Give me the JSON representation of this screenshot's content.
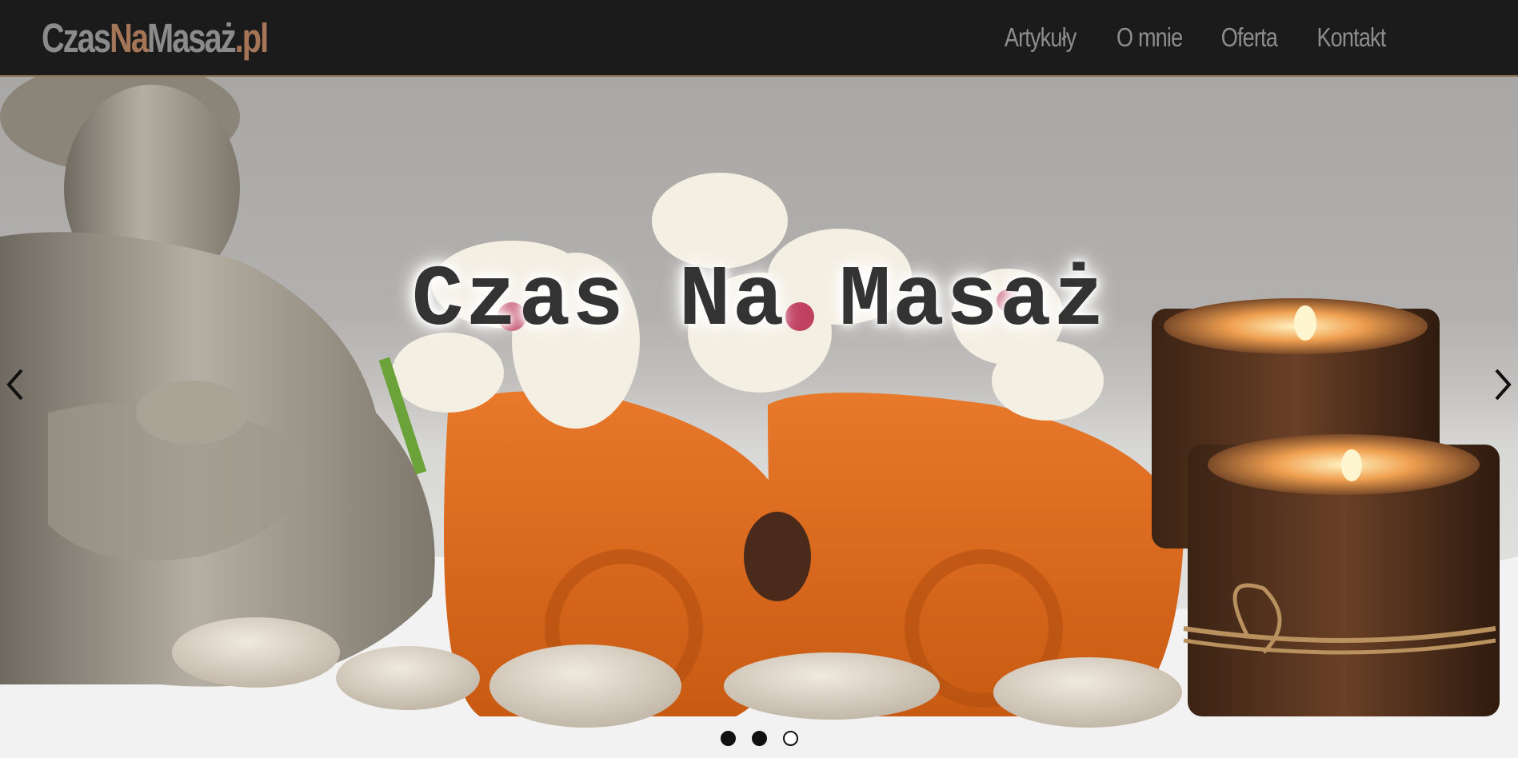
{
  "brand": {
    "part1": "Czas",
    "part2": "Na",
    "part3": "Masaż",
    "part4": ".pl",
    "color_main": "#8b8b8b",
    "color_accent": "#a47556"
  },
  "nav": {
    "items": [
      {
        "label": "Artykuły"
      },
      {
        "label": "O mnie"
      },
      {
        "label": "Oferta"
      },
      {
        "label": "Kontakt"
      }
    ]
  },
  "hero": {
    "title": "Czas Na Masaż",
    "image": "spa-scene-buddha-towels-orchids-candles-stones",
    "prev_icon": "chevron-left-icon",
    "next_icon": "chevron-right-icon",
    "indicators": [
      {
        "state": "filled"
      },
      {
        "state": "filled"
      },
      {
        "state": "outline"
      }
    ]
  }
}
